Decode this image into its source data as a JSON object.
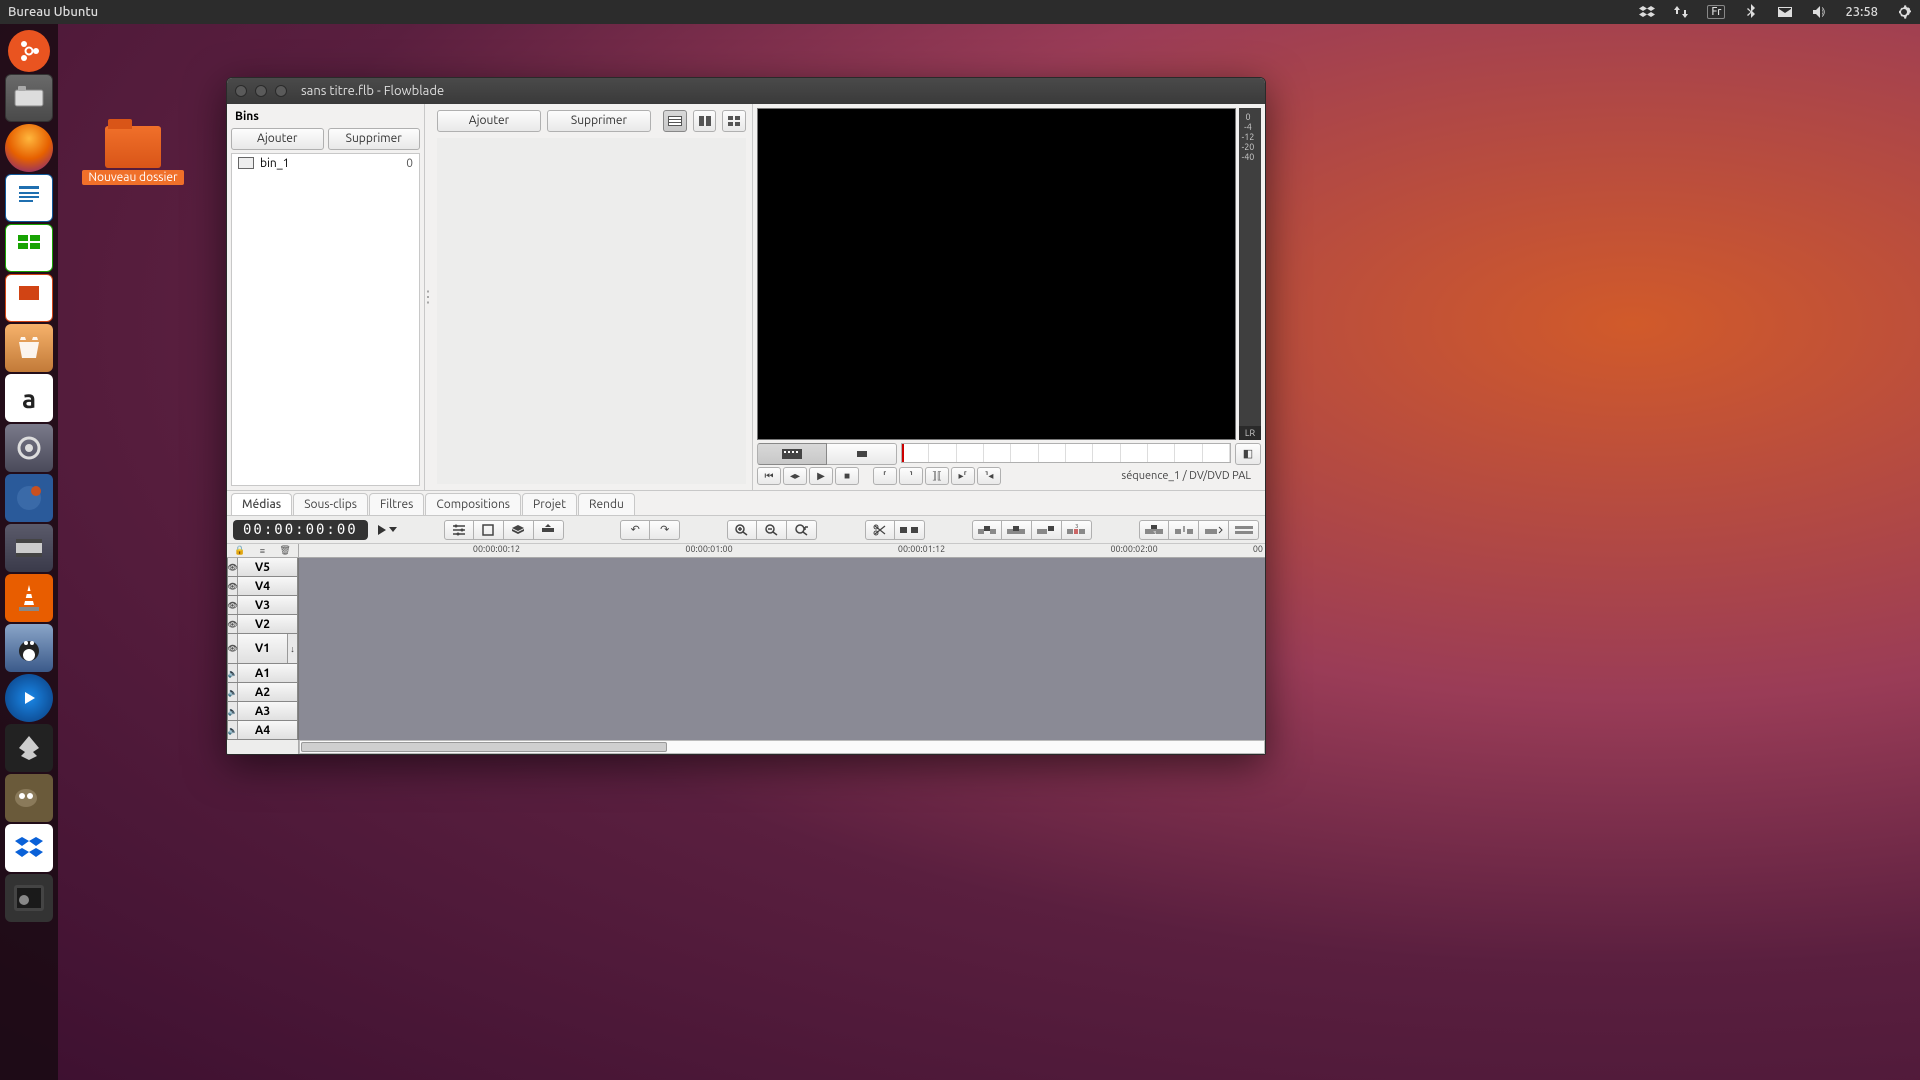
{
  "menubar": {
    "title": "Bureau Ubuntu"
  },
  "tray": {
    "lang": "Fr",
    "clock": "23:58"
  },
  "desktop_folder": {
    "label": "Nouveau dossier"
  },
  "window": {
    "title": "sans titre.flb - Flowblade"
  },
  "bins": {
    "heading": "Bins",
    "add": "Ajouter",
    "delete": "Supprimer",
    "items": [
      {
        "name": "bin_1",
        "count": "0"
      }
    ]
  },
  "media": {
    "add": "Ajouter",
    "delete": "Supprimer"
  },
  "meter": {
    "ticks": [
      "0",
      "-4",
      "-12",
      "-20",
      "-40"
    ],
    "lr": "LR"
  },
  "monitor": {
    "sequence_label": "séquence_1 / DV/DVD PAL"
  },
  "tabs": [
    "Médias",
    "Sous-clips",
    "Filtres",
    "Compositions",
    "Projet",
    "Rendu"
  ],
  "timecode": "00:00:00:00",
  "ruler": {
    "labels": [
      "00:00:00:12",
      "00:00:01:00",
      "00:00:01:12",
      "00:00:02:00",
      "00"
    ]
  },
  "tracks": {
    "video": [
      "V5",
      "V4",
      "V3",
      "V2",
      "V1"
    ],
    "audio": [
      "A1",
      "A2",
      "A3",
      "A4"
    ]
  }
}
